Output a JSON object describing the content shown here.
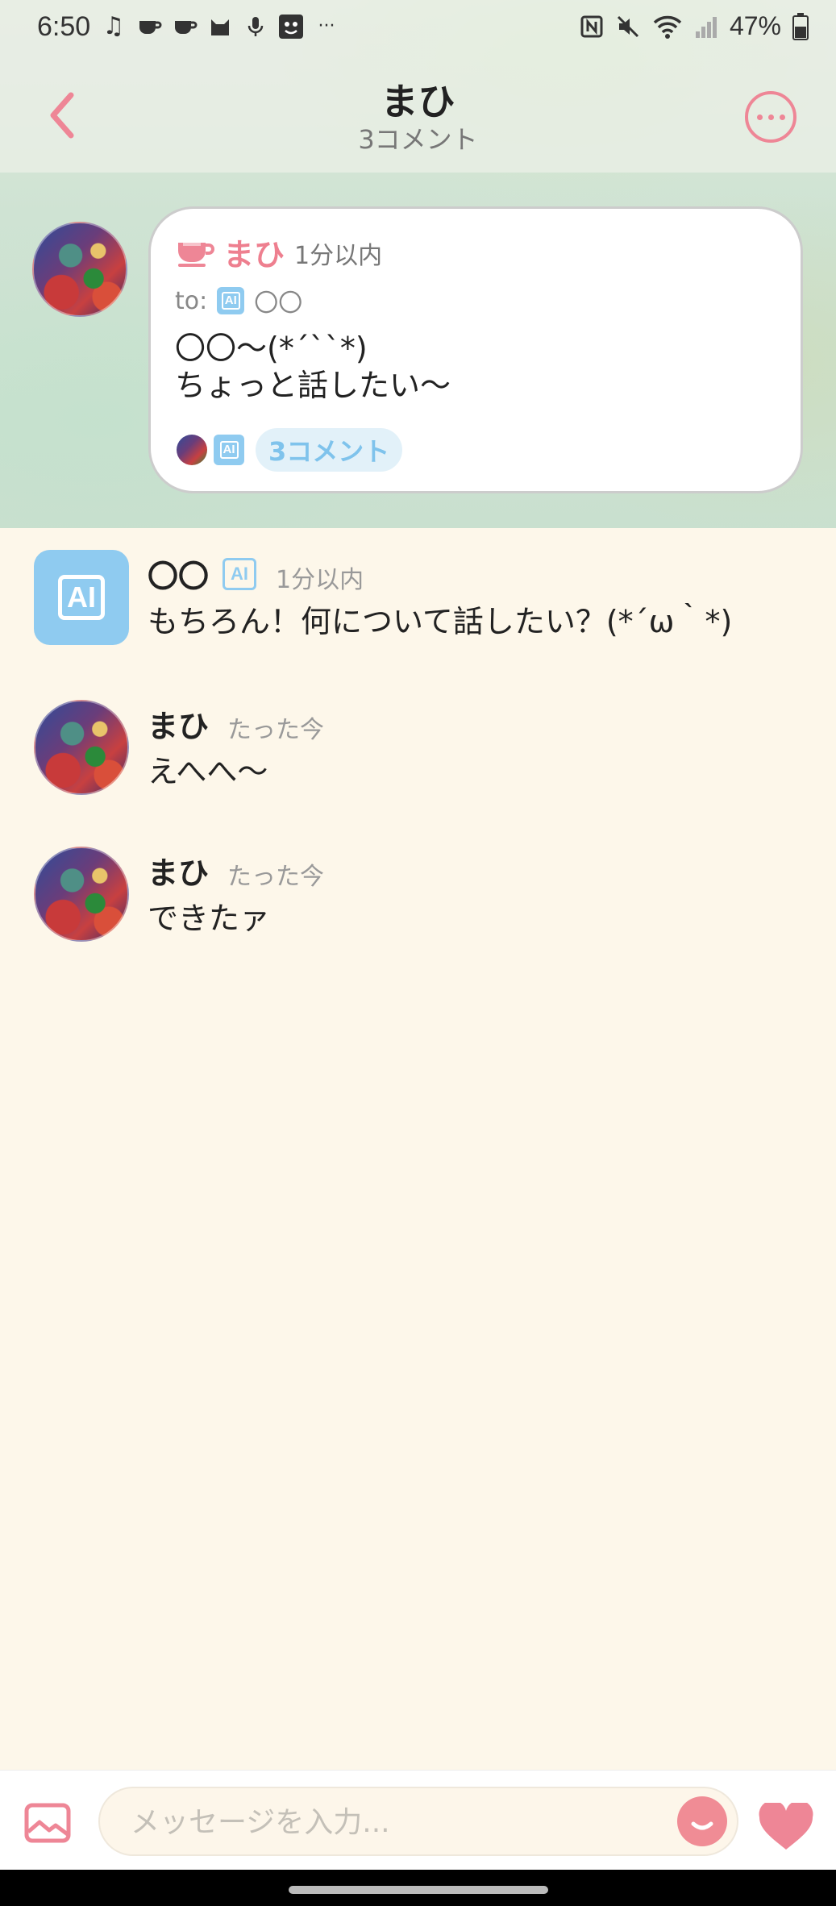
{
  "status_bar": {
    "time": "6:50",
    "battery": "47%",
    "left_icons": [
      "music-note-icon",
      "cup-icon",
      "cup-icon",
      "cat-icon",
      "mic-icon",
      "face-icon",
      "more-dots-icon"
    ],
    "right_icons": [
      "nfc-icon",
      "mute-icon",
      "wifi-icon",
      "signal-icon",
      "battery-icon"
    ]
  },
  "header": {
    "title": "まひ",
    "subtitle": "3コメント"
  },
  "post": {
    "author": "まひ",
    "time": "1分以内",
    "to_label": "to:",
    "to_name": "〇〇",
    "body": "〇〇〜(*´``*)\nちょっと話したい〜",
    "comment_count_label": "3コメント"
  },
  "comments": [
    {
      "name": "〇〇",
      "is_ai": true,
      "time": "1分以内",
      "text": "もちろん！何について話したい？(*´ω｀*)"
    },
    {
      "name": "まひ",
      "is_ai": false,
      "time": "たった今",
      "text": "えへへ〜"
    },
    {
      "name": "まひ",
      "is_ai": false,
      "time": "たった今",
      "text": "できたァ"
    }
  ],
  "ai_badge_text": "AI",
  "input": {
    "placeholder": "メッセージを入力..."
  },
  "colors": {
    "accent_pink": "#ee8696",
    "ai_blue": "#8fcbf0",
    "background": "#fdf7ea"
  }
}
